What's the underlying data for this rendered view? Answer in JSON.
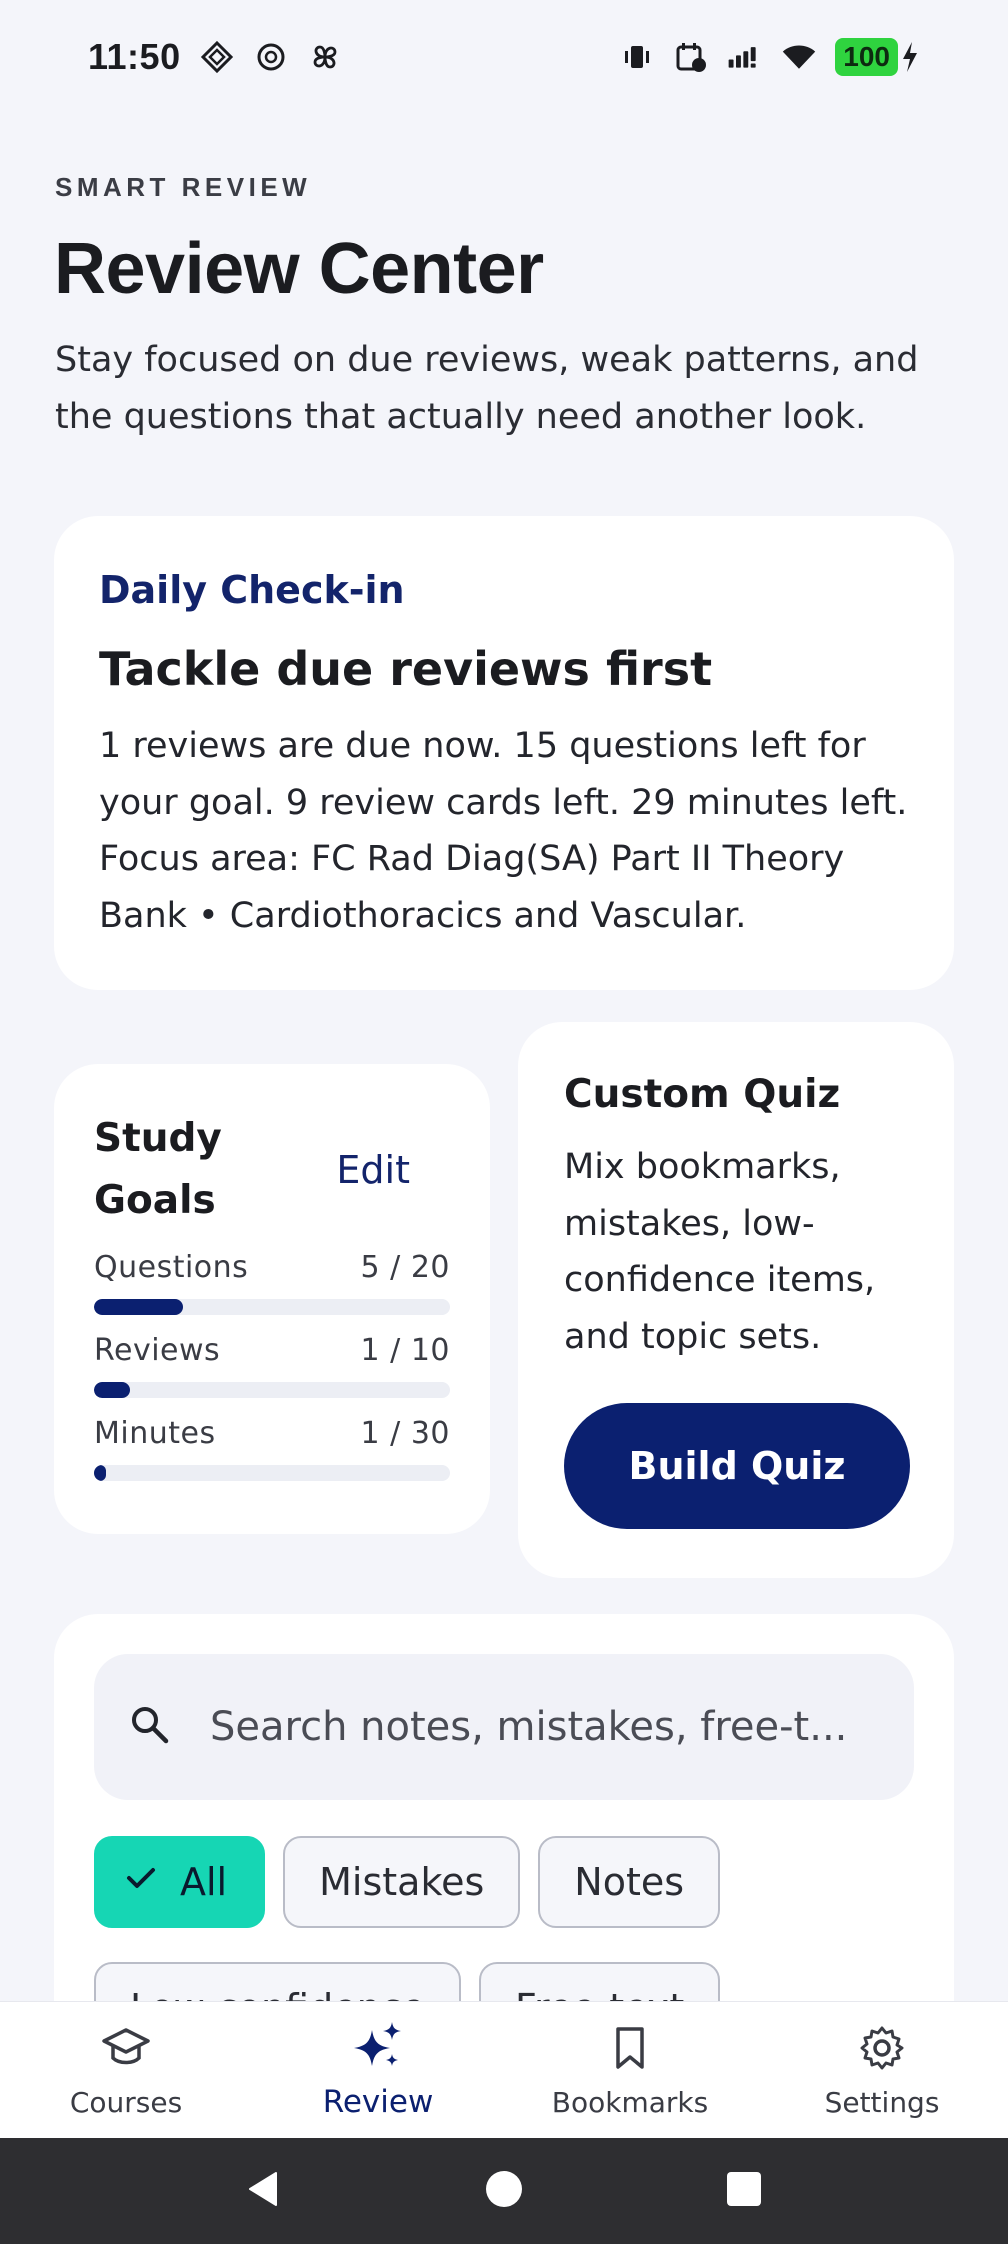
{
  "status_bar": {
    "time": "11:50",
    "battery": "100"
  },
  "header": {
    "eyebrow": "SMART REVIEW",
    "title": "Review Center",
    "subtitle": "Stay focused on due reviews, weak patterns, and the questions that actually need another look."
  },
  "checkin": {
    "kicker": "Daily Check-in",
    "title": "Tackle due reviews first",
    "body": "1 reviews are due now. 15 questions left for your goal. 9 review cards left. 29 minutes left. Focus area: FC Rad Diag(SA) Part II Theory Bank • Cardiothoracics and Vascular."
  },
  "study_goals": {
    "title": "Study Goals",
    "edit_label": "Edit",
    "goals": [
      {
        "label": "Questions",
        "value": "5 / 20",
        "fraction": 0.25
      },
      {
        "label": "Reviews",
        "value": "1 / 10",
        "fraction": 0.1
      },
      {
        "label": "Minutes",
        "value": "1 / 30",
        "fraction": 0.033
      }
    ]
  },
  "custom_quiz": {
    "title": "Custom Quiz",
    "description": "Mix bookmarks, mistakes, low-confidence items, and topic sets.",
    "button_label": "Build Quiz"
  },
  "search": {
    "placeholder": "Search notes, mistakes, free-t..."
  },
  "filters": {
    "selected": "All",
    "items": [
      "All",
      "Mistakes",
      "Notes",
      "Low confidence",
      "Free-text"
    ]
  },
  "bottom_nav": {
    "items": [
      {
        "label": "Courses",
        "icon": "graduation-cap-icon"
      },
      {
        "label": "Review",
        "icon": "sparkles-icon",
        "active": true
      },
      {
        "label": "Bookmarks",
        "icon": "bookmark-icon"
      },
      {
        "label": "Settings",
        "icon": "gear-icon"
      }
    ]
  },
  "colors": {
    "accent": "#0b2070",
    "chip_selected": "#16d6b4",
    "background": "#f4f5fa"
  }
}
